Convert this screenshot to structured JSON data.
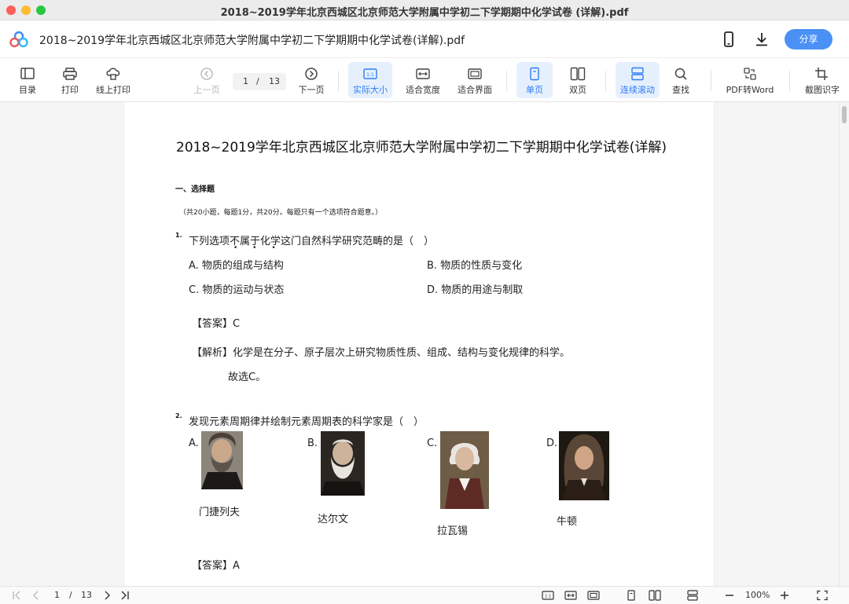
{
  "window": {
    "title": "2018~2019学年北京西城区北京师范大学附属中学初二下学期期中化学试卷 (详解).pdf"
  },
  "header": {
    "file_name": "2018~2019学年北京西城区北京师范大学附属中学初二下学期期中化学试卷(详解).pdf",
    "share_label": "分享"
  },
  "toolbar": {
    "toc": "目录",
    "print": "打印",
    "online_print": "线上打印",
    "prev_page": "上一页",
    "current_page": "1",
    "page_sep": "/",
    "total_pages": "13",
    "next_page": "下一页",
    "actual_size": "实际大小",
    "fit_width": "适合宽度",
    "fit_page": "适合界面",
    "single_page": "单页",
    "double_page": "双页",
    "continuous": "连续滚动",
    "find": "查找",
    "pdf_to_word": "PDF转Word",
    "ocr": "截图识字",
    "actual_size_icon_text": "1:1",
    "active_color": "#2f7cf6"
  },
  "document": {
    "title": "2018~2019学年北京西城区北京师范大学附属中学初二下学期期中化学试卷(详解)",
    "section_title": "一、选择题",
    "section_note": "（共20小题，每题1分，共20分。每题只有一个选项符合题意。）",
    "q1": {
      "number": "1.",
      "text": "下列选项不属于化学这门自然科学研究范畴的是（　）",
      "emphasis_dots": "• • •",
      "options": [
        "A. 物质的组成与结构",
        "B. 物质的性质与变化",
        "C. 物质的运动与状态",
        "D. 物质的用途与制取"
      ],
      "answer_label": "【答案】",
      "answer": "C",
      "analysis_label": "【解析】",
      "analysis": "化学是在分子、原子层次上研究物质性质、组成、结构与变化规律的科学。",
      "conclusion": "故选C。"
    },
    "q2": {
      "number": "2.",
      "text": "发现元素周期律并绘制元素周期表的科学家是（　）",
      "option_letters": [
        "A.",
        "B.",
        "C.",
        "D."
      ],
      "captions": [
        "门捷列夫",
        "达尔文",
        "拉瓦锡",
        "牛顿"
      ],
      "answer_label": "【答案】",
      "answer": "A"
    }
  },
  "statusbar": {
    "current_page": "1",
    "sep": "/",
    "total_pages": "13",
    "zoom": "100%",
    "actual_size_icon_text": "1:1"
  }
}
